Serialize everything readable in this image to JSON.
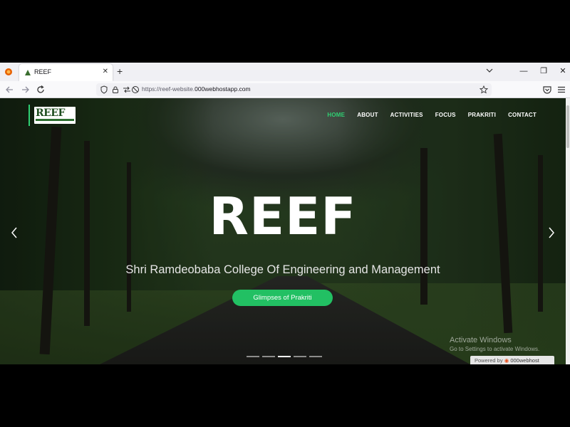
{
  "browser": {
    "tab": {
      "title": "REEF"
    },
    "new_tab_label": "+",
    "tab_close_label": "✕",
    "window_controls": {
      "minimize": "—",
      "restore": "❐",
      "close": "✕"
    },
    "url": {
      "prefix": "https://reef-website.",
      "domain": "000webhostapp.com"
    }
  },
  "site": {
    "logo_text": "REEF",
    "nav": [
      {
        "label": "HOME",
        "active": true
      },
      {
        "label": "ABOUT"
      },
      {
        "label": "ACTIVITIES"
      },
      {
        "label": "FOCUS"
      },
      {
        "label": "PRAKRITI"
      },
      {
        "label": "CONTACT"
      }
    ],
    "hero": {
      "title": "REEF",
      "subtitle": "Shri Ramdeobaba College Of Engineering and Management",
      "cta_label": "Glimpses of Prakriti",
      "prev_label": "‹",
      "next_label": "›",
      "slide_count": 5,
      "active_slide": 3
    },
    "accent_color": "#2fcf72"
  },
  "overlay": {
    "activate_title": "Activate Windows",
    "activate_sub": "Go to Settings to activate Windows.",
    "powered_prefix": "Powered by",
    "powered_brand": "000webhost"
  }
}
